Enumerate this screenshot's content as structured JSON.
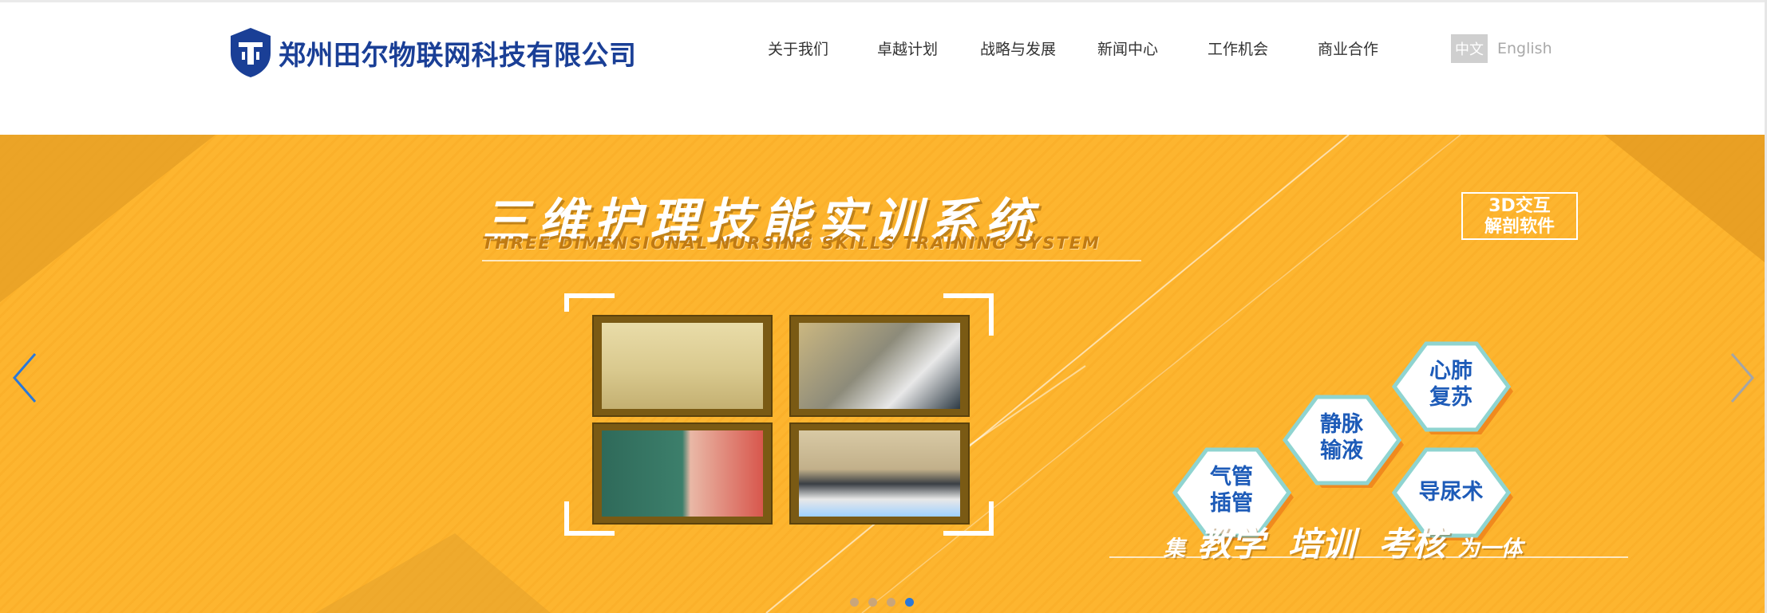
{
  "company": {
    "name": "郑州田尔物联网科技有限公司"
  },
  "nav": {
    "items": [
      {
        "label": "关于我们"
      },
      {
        "label": "卓越计划"
      },
      {
        "label": "战略与发展"
      },
      {
        "label": "新闻中心"
      },
      {
        "label": "工作机会"
      },
      {
        "label": "商业合作"
      }
    ]
  },
  "language": {
    "cn": "中文",
    "en": "English"
  },
  "banner": {
    "title": "三维护理技能实训系统",
    "subtitle": "THREE DIMENSIONAL NURSING SKILLS TRAINING SYSTEM",
    "badge_line1": "3D交互",
    "badge_line2": "解剖软件",
    "hexagons": [
      {
        "line1": "心肺",
        "line2": "复苏"
      },
      {
        "line1": "静脉",
        "line2": "输液"
      },
      {
        "line1": "气管",
        "line2": "插管"
      },
      {
        "line1": "导尿术",
        "line2": ""
      }
    ],
    "tagline": {
      "prefix": "集",
      "words": "教学  培训  考核",
      "suffix": "为一体"
    }
  },
  "carousel": {
    "slide_count": 4,
    "active_slide": 4
  },
  "colors": {
    "brand": "#1a3f96",
    "banner_bg": "#fdb52f",
    "active_dot": "#2a78d8",
    "arrow": "#2a78d8"
  },
  "icons": {
    "logo": "shield-logo-icon",
    "prev": "chevron-left-icon",
    "next": "chevron-right-icon"
  }
}
